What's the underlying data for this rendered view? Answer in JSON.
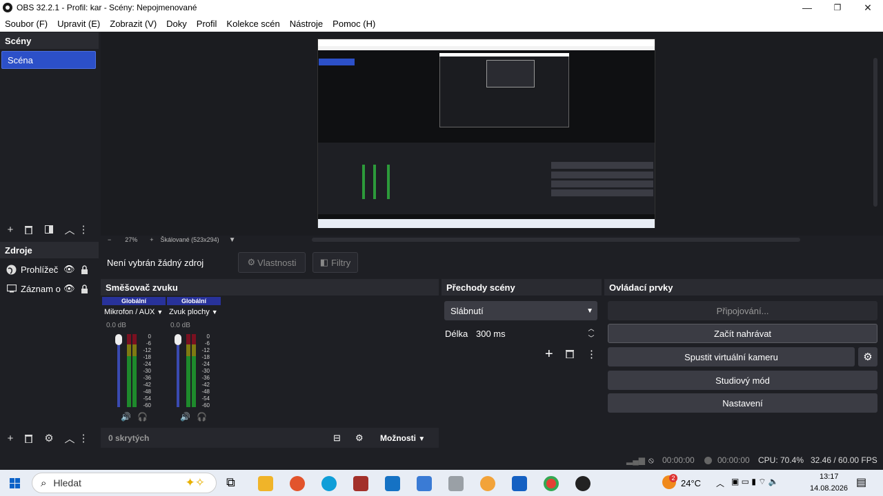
{
  "window": {
    "title": "OBS 32.2.1 - Profil: kar - Scény: Nepojmenované",
    "minimize": "—",
    "maximize": "❐",
    "close": "✕"
  },
  "menu": [
    "Soubor (F)",
    "Upravit (E)",
    "Zobrazit (V)",
    "Doky",
    "Profil",
    "Kolekce scén",
    "Nástroje",
    "Pomoc (H)"
  ],
  "scenes": {
    "title": "Scény",
    "items": [
      "Scéna"
    ]
  },
  "sources": {
    "title": "Zdroje",
    "items": [
      {
        "label": "Prohlížeč",
        "icon": "globe-icon"
      },
      {
        "label": "Záznam o",
        "icon": "monitor-icon"
      }
    ]
  },
  "preview": {
    "zoom": "27%",
    "scale_label": "Škálované (523x294)"
  },
  "source_bar": {
    "no_source": "Není vybrán žádný zdroj",
    "properties": "Vlastnosti",
    "filters": "Filtry"
  },
  "mixer": {
    "title": "Směšovač zvuku",
    "channels": [
      {
        "tag": "Globální",
        "name": "Mikrofon / AUX",
        "level": "0.0 dB"
      },
      {
        "tag": "Globální",
        "name": "Zvuk plochy",
        "level": "0.0 dB"
      }
    ],
    "scale": [
      "0",
      "-6",
      "-12",
      "-18",
      "-24",
      "-30",
      "-36",
      "-42",
      "-48",
      "-54",
      "-60"
    ],
    "hidden": "0 skrytých",
    "options": "Možnosti"
  },
  "transitions": {
    "title": "Přechody scény",
    "selected": "Slábnutí",
    "duration_label": "Délka",
    "duration_value": "300 ms"
  },
  "controls": {
    "title": "Ovládací prvky",
    "connecting": "Připojování...",
    "record": "Začít nahrávat",
    "virtual_cam": "Spustit virtuální kameru",
    "studio": "Studiový mód",
    "settings": "Nastavení"
  },
  "status": {
    "stream_time": "00:00:00",
    "record_time": "00:00:00",
    "cpu": "CPU: 70.4%",
    "fps": "32.46 / 60.00 FPS"
  },
  "taskbar": {
    "search": "Hledat",
    "temperature": "24°C",
    "notification_count": "2",
    "time": "13:17",
    "date": "14.08.2026"
  },
  "colors": {
    "accent": "#2c50c8",
    "panel": "#1e1f24",
    "header": "#2a2b31",
    "button": "#3b3c44"
  }
}
